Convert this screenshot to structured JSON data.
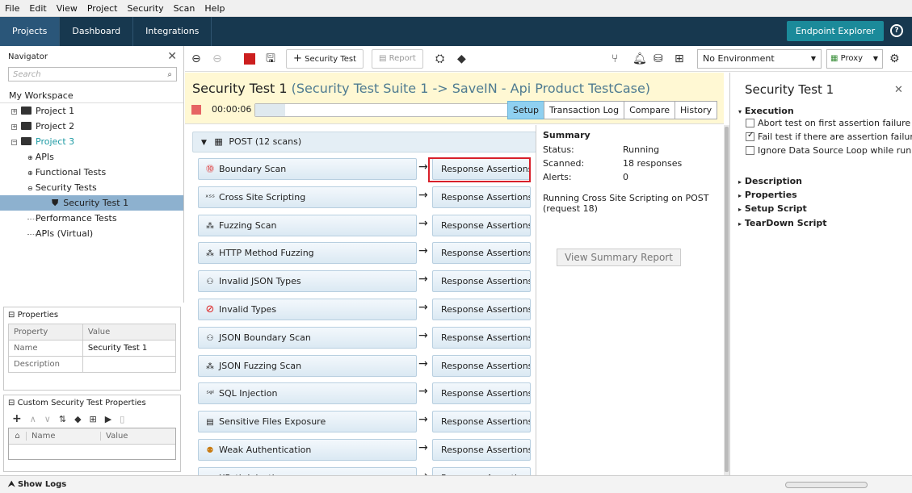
{
  "menubar": [
    "File",
    "Edit",
    "View",
    "Project",
    "Security",
    "Scan",
    "Help"
  ],
  "topnav": {
    "tabs": [
      "Projects",
      "Dashboard",
      "Integrations"
    ],
    "active_tab": "Projects",
    "endpoint_explorer": "Endpoint Explorer",
    "help_icon": "help-circle-icon"
  },
  "navigator": {
    "title": "Navigator",
    "search_placeholder": "Search",
    "workspace": "My Workspace",
    "tree": [
      {
        "label": "Project 1"
      },
      {
        "label": "Project 2"
      },
      {
        "label": "Project 3"
      },
      {
        "label": "APIs"
      },
      {
        "label": "Functional Tests"
      },
      {
        "label": "Security Tests"
      },
      {
        "label": "Security Test 1"
      },
      {
        "label": "Performance Tests"
      },
      {
        "label": "APIs (Virtual)"
      }
    ]
  },
  "properties": {
    "title": "Properties",
    "headers": [
      "Property",
      "Value"
    ],
    "rows": [
      {
        "name": "Name",
        "value": "Security Test 1"
      },
      {
        "name": "Description",
        "value": ""
      }
    ]
  },
  "custom_props": {
    "title": "Custom Security Test Properties",
    "headers": [
      "Name",
      "Value"
    ]
  },
  "statusbar": {
    "show_logs": "Show Logs"
  },
  "toolbar": {
    "security_test": "Security Test",
    "report": "Report",
    "environment": "No Environment",
    "proxy": "Proxy"
  },
  "test": {
    "title": "Security Test 1",
    "subtitle": "(Security Test Suite 1 -> SaveIN - Api Product TestCase)",
    "timer": "00:00:06",
    "progress": 0.07,
    "tabs": [
      "Setup",
      "Transaction Log",
      "Compare",
      "History"
    ],
    "active_tab": "Setup"
  },
  "scans": {
    "post_header": "POST (12 scans)",
    "assertion_label": "Response Assertions",
    "items": [
      {
        "label": "Boundary Scan",
        "icon": "boundary-icon",
        "glyph": "⓾"
      },
      {
        "label": "Cross Site Scripting",
        "icon": "xss-icon",
        "glyph": "ˣˢˢ"
      },
      {
        "label": "Fuzzing Scan",
        "icon": "fuzzing-icon",
        "glyph": "⁂"
      },
      {
        "label": "HTTP Method Fuzzing",
        "icon": "http-fuzzing-icon",
        "glyph": "⁂"
      },
      {
        "label": "Invalid JSON Types",
        "icon": "json-types-icon",
        "glyph": "⚇"
      },
      {
        "label": "Invalid Types",
        "icon": "invalid-types-icon",
        "glyph": "⊘"
      },
      {
        "label": "JSON Boundary Scan",
        "icon": "json-boundary-icon",
        "glyph": "⚇"
      },
      {
        "label": "JSON Fuzzing Scan",
        "icon": "json-fuzzing-icon",
        "glyph": "⁂"
      },
      {
        "label": "SQL Injection",
        "icon": "sql-injection-icon",
        "glyph": "ˢᵠˡ"
      },
      {
        "label": "Sensitive Files Exposure",
        "icon": "sensitive-files-icon",
        "glyph": "▤"
      },
      {
        "label": "Weak Authentication",
        "icon": "weak-auth-icon",
        "glyph": "⚉"
      },
      {
        "label": "XPath Injection",
        "icon": "xpath-icon",
        "glyph": "ˣᵖ"
      }
    ]
  },
  "summary": {
    "title": "Summary",
    "status_label": "Status:",
    "status_value": "Running",
    "scanned_label": "Scanned:",
    "scanned_value": "18 responses",
    "alerts_label": "Alerts:",
    "alerts_value": "0",
    "running_text": "Running Cross Site Scripting on POST (request 18)",
    "view_report": "View Summary Report"
  },
  "right_panel": {
    "title": "Security Test 1",
    "execution": "Execution",
    "options": [
      {
        "label": "Abort test on first assertion failure",
        "checked": false
      },
      {
        "label": "Fail test if there are assertion failures",
        "checked": true
      },
      {
        "label": "Ignore Data Source Loop while running",
        "checked": false
      }
    ],
    "sections": [
      "Description",
      "Properties",
      "Setup Script",
      "TearDown Script"
    ]
  },
  "colors": {
    "nav_bg": "#17384f",
    "accent": "#1b8a9a",
    "highlight": "#d8202a",
    "selected": "#8db1cf"
  }
}
